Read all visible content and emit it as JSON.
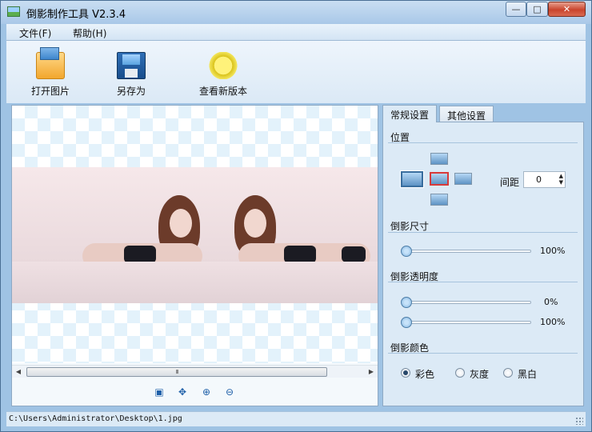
{
  "window": {
    "title": "倒影制作工具 V2.3.4",
    "controls": {
      "minimize": "—",
      "maximize": "□",
      "close": "✕"
    }
  },
  "menu": {
    "file": "文件(F)",
    "help": "帮助(H)"
  },
  "toolbar": {
    "open_image": "打开图片",
    "save_as": "另存为",
    "check_update": "查看新版本"
  },
  "canvas": {
    "zoom_controls": [
      {
        "name": "fit-window-icon",
        "glyph": "▣"
      },
      {
        "name": "actual-size-icon",
        "glyph": "✥"
      },
      {
        "name": "zoom-in-icon",
        "glyph": "⊕"
      },
      {
        "name": "zoom-out-icon",
        "glyph": "⊖"
      }
    ],
    "scroll_grip": "III",
    "scroll_left": "◀",
    "scroll_right": "▶"
  },
  "tabs": {
    "general": "常规设置",
    "other": "其他设置"
  },
  "settings": {
    "position": {
      "label": "位置",
      "selected": "center",
      "spacing_label": "间距",
      "spacing_value": "0",
      "spin_up": "▲",
      "spin_down": "▼"
    },
    "reflection_size": {
      "label": "倒影尺寸",
      "value_percent": 100,
      "value_text": "100%"
    },
    "reflection_opacity": {
      "label": "倒影透明度",
      "start_percent": 0,
      "start_text": "0%",
      "end_percent": 100,
      "end_text": "100%"
    },
    "reflection_color": {
      "label": "倒影颜色",
      "options": [
        "彩色",
        "灰度",
        "黑白"
      ],
      "selected": "彩色"
    }
  },
  "status": {
    "path": "C:\\Users\\Administrator\\Desktop\\1.jpg"
  }
}
